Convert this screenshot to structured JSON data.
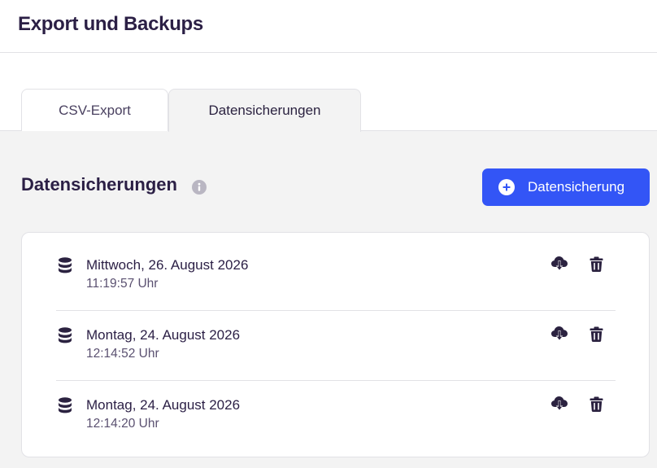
{
  "header": {
    "title": "Export und Backups"
  },
  "tabs": [
    {
      "label": "CSV-Export",
      "active": false
    },
    {
      "label": "Datensicherungen",
      "active": true
    }
  ],
  "section": {
    "title": "Datensicherungen",
    "add_button_label": "Datensicherung",
    "info_icon": "info-icon"
  },
  "backups": [
    {
      "date": "Mittwoch, 26. August 2026",
      "time": "11:19:57 Uhr"
    },
    {
      "date": "Montag, 24. August 2026",
      "time": "12:14:52 Uhr"
    },
    {
      "date": "Montag, 24. August 2026",
      "time": "12:14:20 Uhr"
    }
  ],
  "colors": {
    "accent": "#3355f6",
    "text_dark": "#2b1f45",
    "icon_dark": "#2b2240",
    "info_grey": "#b9b6c2",
    "background": "#f3f3f3"
  }
}
